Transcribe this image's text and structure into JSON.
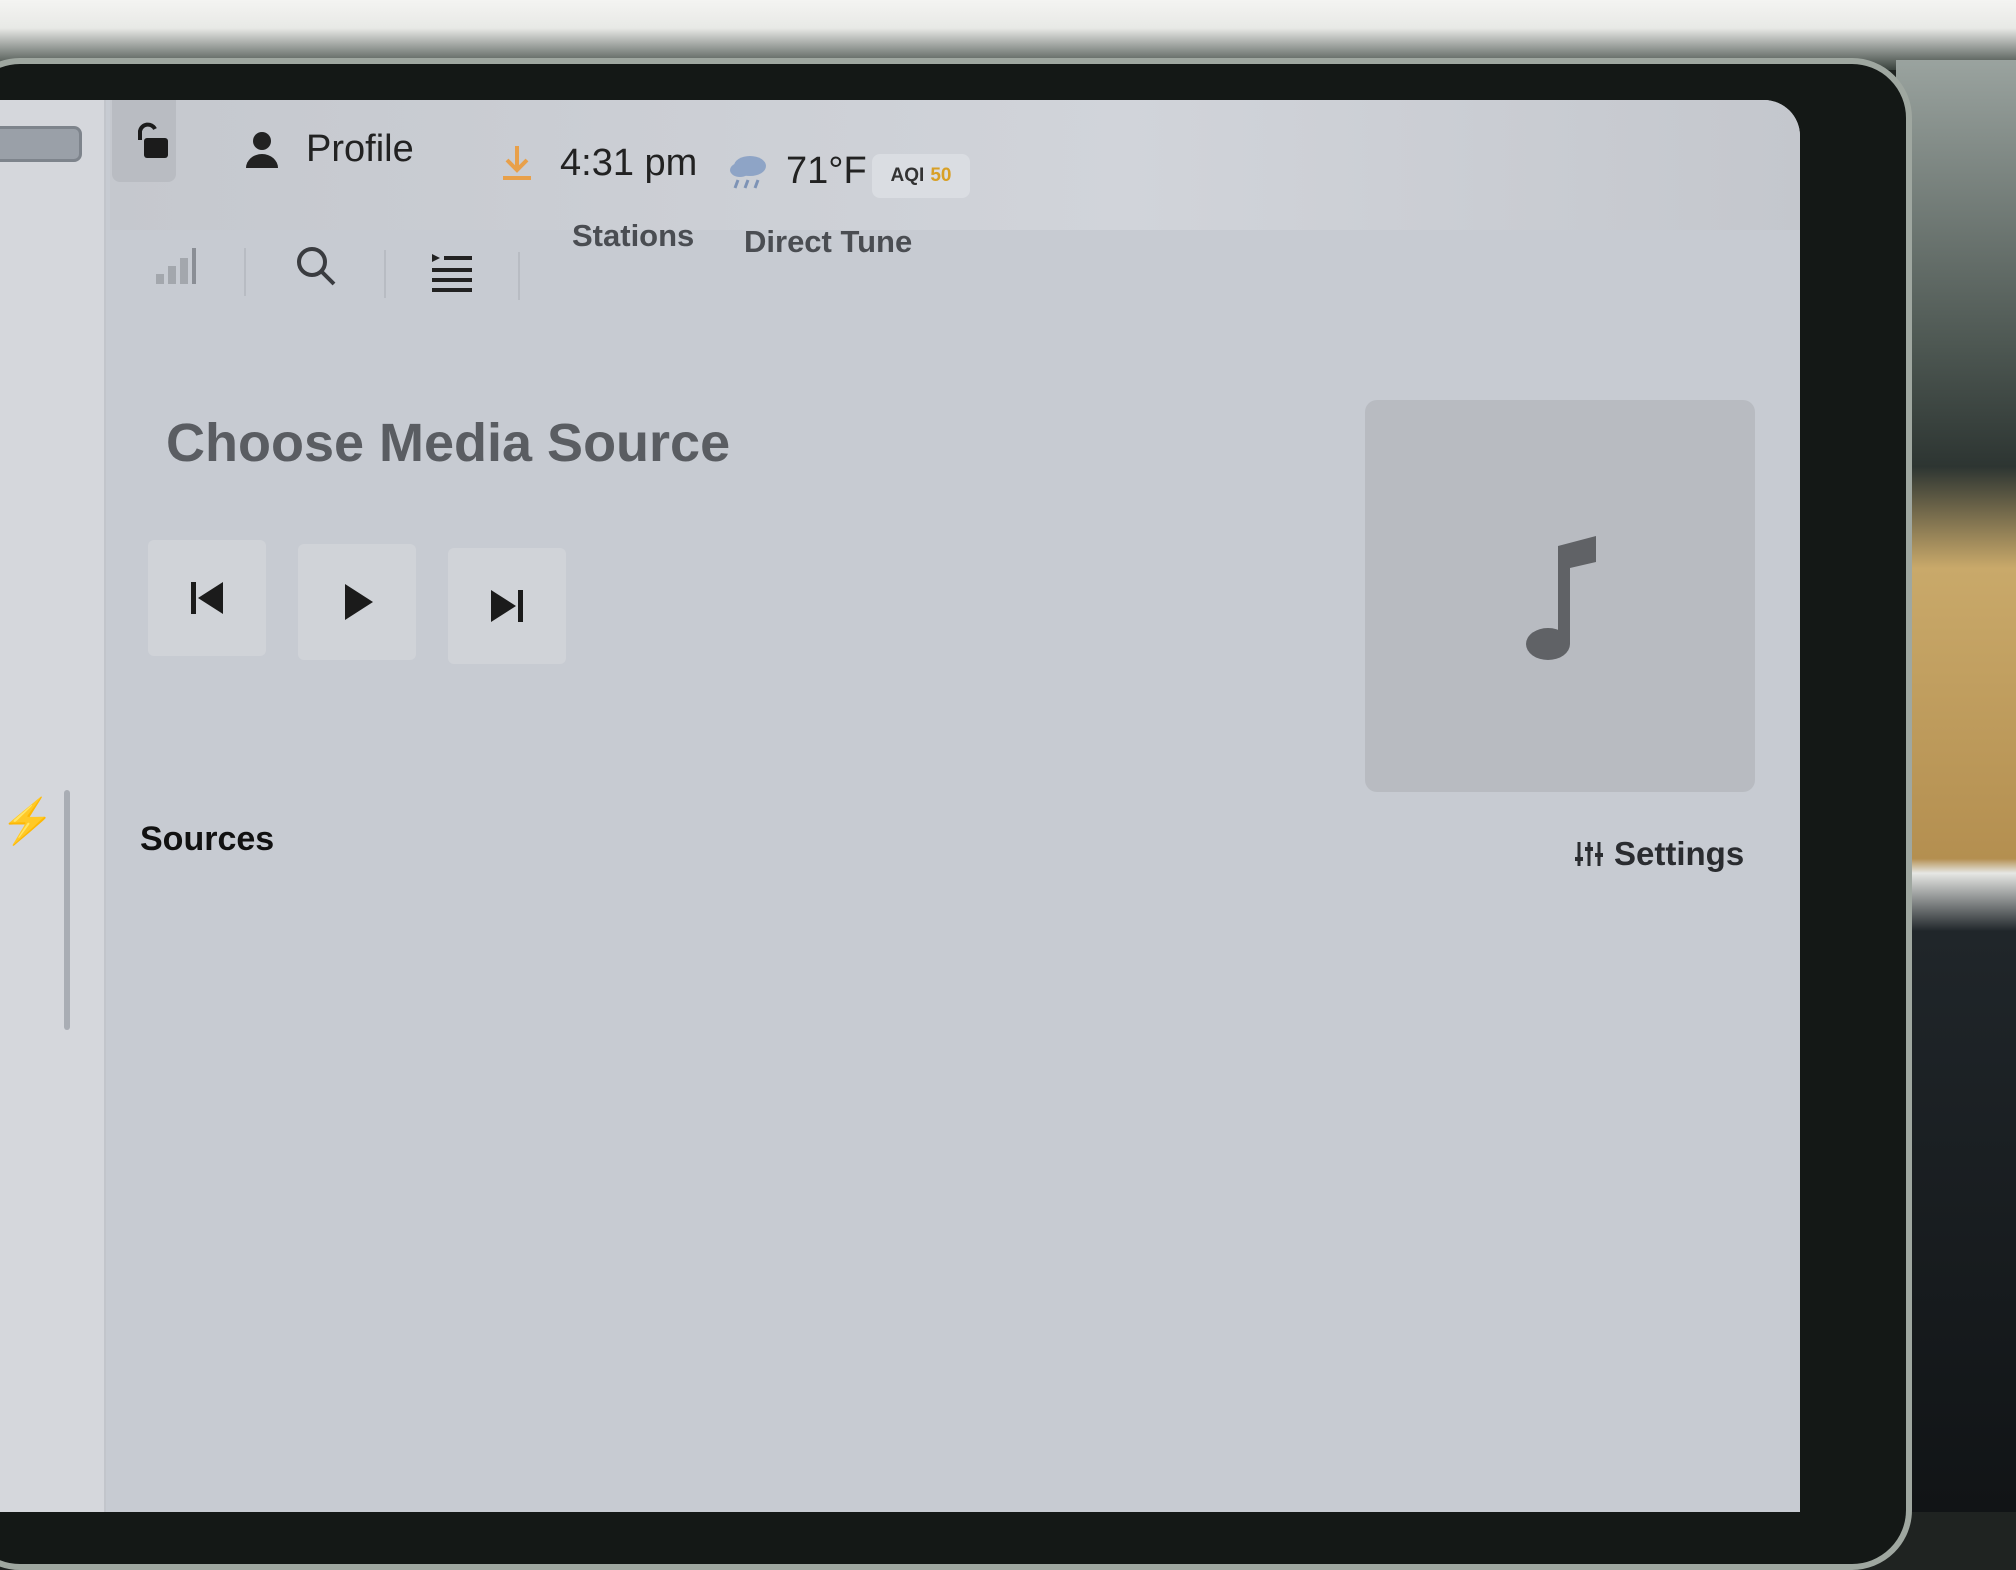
{
  "status_bar": {
    "profile_label": "Profile",
    "time": "4:31 pm",
    "temperature": "71°F",
    "aqi_label": "AQI",
    "aqi_value": "50"
  },
  "toolbar": {
    "tabs": [
      {
        "label": "Stations"
      },
      {
        "label": "Direct Tune"
      }
    ]
  },
  "media": {
    "title": "Choose Media Source",
    "sources_label": "Sources",
    "settings_label": "Settings"
  },
  "icons": {
    "status": [
      "lock-open-icon",
      "profile-icon",
      "download-icon",
      "weather-rain-icon"
    ],
    "toolbar": [
      "signal-bars-icon",
      "search-icon",
      "queue-list-icon"
    ],
    "controls": [
      "previous-track-icon",
      "play-icon",
      "next-track-icon"
    ],
    "album_art": "music-note-icon",
    "settings": "sliders-icon"
  },
  "colors": {
    "accent_orange": "#e8a04a",
    "aqi_yellow": "#d8a026",
    "screen_bg": "#c7cbd2"
  }
}
